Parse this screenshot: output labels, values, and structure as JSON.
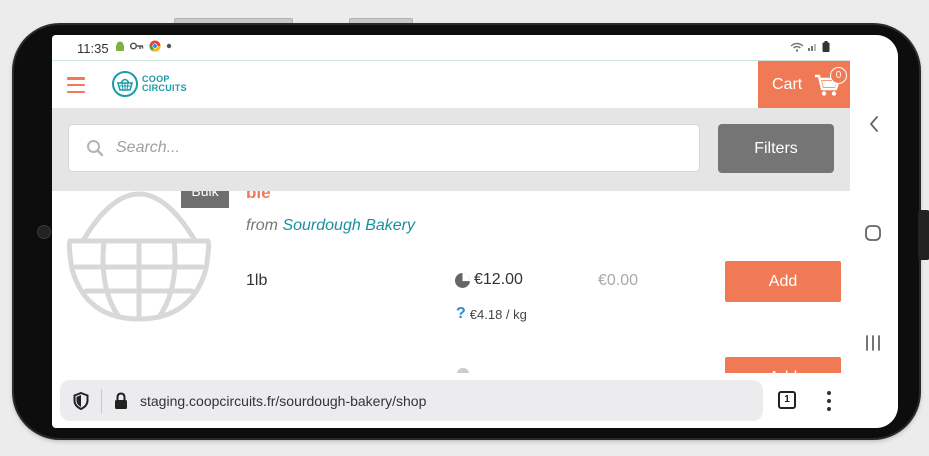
{
  "status_bar": {
    "time": "11:35",
    "notification_icons": [
      "android-icon",
      "key-icon",
      "chrome-icon",
      "dot-icon"
    ],
    "right_icons": [
      "wifi-icon",
      "signal-icon",
      "battery-icon"
    ]
  },
  "app": {
    "logo": "COOP CIRCUITS",
    "cart": {
      "label": "Cart",
      "count": "0"
    },
    "search": {
      "placeholder": "Search..."
    },
    "filters_label": "Filters",
    "product": {
      "tag": "Bulk",
      "title_fragment": "bie",
      "from_label": "from",
      "producer": "Sourdough Bakery",
      "variant": {
        "unit": "1lb",
        "price": "€12.00",
        "total": "€0.00",
        "unit_price": "€4.18 / kg",
        "add_label": "Add"
      },
      "next_variant": {
        "add_label": "Add"
      }
    }
  },
  "browser": {
    "url": "staging.coopcircuits.fr/sourdough-bakery/shop",
    "tab_count": "1"
  },
  "colors": {
    "accent": "#f07a55",
    "brand": "#1a9ba8",
    "filters_bg": "#757575",
    "search_bg": "#e5e5e5"
  }
}
